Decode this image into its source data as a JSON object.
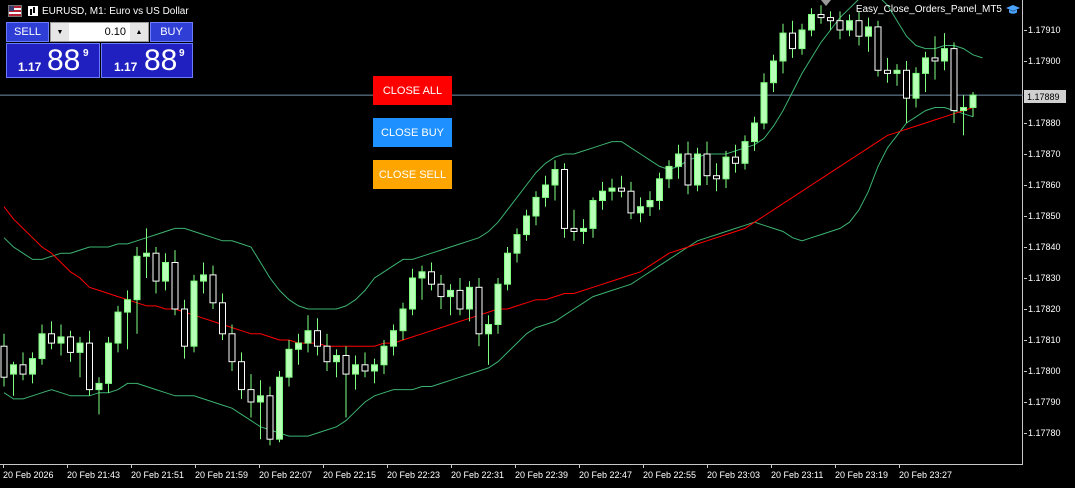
{
  "window": {
    "symbol_title": "EURUSD, M1:  Euro vs US Dollar",
    "ea_name": "Easy_Close_Orders_Panel_MT5"
  },
  "trade_panel": {
    "sell_label": "SELL",
    "buy_label": "BUY",
    "lot_value": "0.10",
    "sell_price": {
      "prefix": "1.17",
      "big": "88",
      "sup": "9"
    },
    "buy_price": {
      "prefix": "1.17",
      "big": "88",
      "sup": "9"
    }
  },
  "close_panel": {
    "close_all": "CLOSE ALL",
    "close_buy": "CLOSE BUY",
    "close_sell": "CLOSE SELL",
    "colors": {
      "close_all": "#ff0000",
      "close_buy": "#1e90ff",
      "close_sell": "#ffa500"
    }
  },
  "price_axis": {
    "labels": [
      "1.17910",
      "1.17900",
      "1.17880",
      "1.17870",
      "1.17860",
      "1.17850",
      "1.17840",
      "1.17830",
      "1.17820",
      "1.17810",
      "1.17800",
      "1.17790",
      "1.17780"
    ],
    "current_price": "1.17889"
  },
  "time_axis": {
    "labels": [
      "20 Feb 2026",
      "20 Feb 21:43",
      "20 Feb 21:51",
      "20 Feb 21:59",
      "20 Feb 22:07",
      "20 Feb 22:15",
      "20 Feb 22:23",
      "20 Feb 22:31",
      "20 Feb 22:39",
      "20 Feb 22:47",
      "20 Feb 22:55",
      "20 Feb 23:03",
      "20 Feb 23:11",
      "20 Feb 23:19",
      "20 Feb 23:27"
    ]
  },
  "chart_data": {
    "type": "candlestick",
    "symbol": "EURUSD",
    "timeframe": "M1",
    "ylim": [
      1.17774,
      1.17921
    ],
    "colors": {
      "bull": "#b8ffb8",
      "bear": "#ffffff",
      "ma": "#ff0000",
      "bands": "#3cb371",
      "current_line": "#6f8fa8"
    },
    "candles": [
      [
        1.17808,
        1.17812,
        1.17795,
        1.17798
      ],
      [
        1.17799,
        1.17803,
        1.17792,
        1.17802
      ],
      [
        1.17802,
        1.17806,
        1.17797,
        1.17799
      ],
      [
        1.17799,
        1.17806,
        1.17796,
        1.17804
      ],
      [
        1.17804,
        1.17815,
        1.17802,
        1.17812
      ],
      [
        1.17812,
        1.17816,
        1.17807,
        1.17809
      ],
      [
        1.17809,
        1.17815,
        1.17805,
        1.17811
      ],
      [
        1.17811,
        1.17813,
        1.17803,
        1.17806
      ],
      [
        1.17806,
        1.17811,
        1.17798,
        1.17809
      ],
      [
        1.17809,
        1.17813,
        1.17792,
        1.17794
      ],
      [
        1.17794,
        1.17798,
        1.17786,
        1.17796
      ],
      [
        1.17796,
        1.17811,
        1.17793,
        1.17809
      ],
      [
        1.17809,
        1.17821,
        1.17806,
        1.17819
      ],
      [
        1.17819,
        1.17826,
        1.17807,
        1.17823
      ],
      [
        1.17823,
        1.1784,
        1.17812,
        1.17837
      ],
      [
        1.17837,
        1.17846,
        1.1783,
        1.17838
      ],
      [
        1.17838,
        1.1784,
        1.17825,
        1.17829
      ],
      [
        1.17829,
        1.17838,
        1.17826,
        1.17835
      ],
      [
        1.17835,
        1.17839,
        1.17818,
        1.1782
      ],
      [
        1.1782,
        1.17823,
        1.17804,
        1.17808
      ],
      [
        1.17808,
        1.17831,
        1.17806,
        1.17829
      ],
      [
        1.17829,
        1.17835,
        1.17825,
        1.17831
      ],
      [
        1.17831,
        1.17834,
        1.1782,
        1.17822
      ],
      [
        1.17822,
        1.17825,
        1.1781,
        1.17812
      ],
      [
        1.17812,
        1.17815,
        1.178,
        1.17803
      ],
      [
        1.17803,
        1.17806,
        1.17791,
        1.17794
      ],
      [
        1.17794,
        1.17799,
        1.17785,
        1.1779
      ],
      [
        1.1779,
        1.17797,
        1.17778,
        1.17792
      ],
      [
        1.17792,
        1.17795,
        1.17776,
        1.17778
      ],
      [
        1.17778,
        1.178,
        1.17777,
        1.17798
      ],
      [
        1.17798,
        1.1781,
        1.17795,
        1.17807
      ],
      [
        1.17807,
        1.17812,
        1.17802,
        1.17809
      ],
      [
        1.17809,
        1.17818,
        1.17806,
        1.17813
      ],
      [
        1.17813,
        1.17817,
        1.17805,
        1.17808
      ],
      [
        1.17808,
        1.17812,
        1.178,
        1.17803
      ],
      [
        1.17803,
        1.17807,
        1.17798,
        1.17805
      ],
      [
        1.17805,
        1.17808,
        1.17785,
        1.17799
      ],
      [
        1.17799,
        1.17805,
        1.17794,
        1.17802
      ],
      [
        1.17802,
        1.17806,
        1.17798,
        1.178
      ],
      [
        1.178,
        1.17804,
        1.17796,
        1.17802
      ],
      [
        1.17802,
        1.1781,
        1.17799,
        1.17808
      ],
      [
        1.17808,
        1.17815,
        1.17805,
        1.17813
      ],
      [
        1.17813,
        1.17822,
        1.1781,
        1.1782
      ],
      [
        1.1782,
        1.17833,
        1.17818,
        1.1783
      ],
      [
        1.1783,
        1.17834,
        1.17823,
        1.17832
      ],
      [
        1.17832,
        1.17835,
        1.17826,
        1.17828
      ],
      [
        1.17828,
        1.17831,
        1.1782,
        1.17824
      ],
      [
        1.17824,
        1.17828,
        1.17818,
        1.17826
      ],
      [
        1.17826,
        1.1783,
        1.17818,
        1.1782
      ],
      [
        1.1782,
        1.17829,
        1.17816,
        1.17827
      ],
      [
        1.17827,
        1.1783,
        1.17808,
        1.17812
      ],
      [
        1.17812,
        1.17818,
        1.17802,
        1.17815
      ],
      [
        1.17815,
        1.1783,
        1.17812,
        1.17828
      ],
      [
        1.17828,
        1.1784,
        1.17826,
        1.17838
      ],
      [
        1.17838,
        1.17846,
        1.17835,
        1.17844
      ],
      [
        1.17844,
        1.17852,
        1.17842,
        1.1785
      ],
      [
        1.1785,
        1.17858,
        1.17847,
        1.17856
      ],
      [
        1.17856,
        1.17863,
        1.17853,
        1.1786
      ],
      [
        1.1786,
        1.17868,
        1.17855,
        1.17865
      ],
      [
        1.17865,
        1.17867,
        1.17843,
        1.17846
      ],
      [
        1.17846,
        1.17852,
        1.17842,
        1.17845
      ],
      [
        1.17845,
        1.17849,
        1.17841,
        1.17846
      ],
      [
        1.17846,
        1.17856,
        1.17843,
        1.17855
      ],
      [
        1.17855,
        1.17861,
        1.17852,
        1.17858
      ],
      [
        1.17858,
        1.17862,
        1.17855,
        1.17859
      ],
      [
        1.17859,
        1.17863,
        1.17856,
        1.17858
      ],
      [
        1.17858,
        1.17861,
        1.17849,
        1.17851
      ],
      [
        1.17851,
        1.17856,
        1.17848,
        1.17853
      ],
      [
        1.17853,
        1.17858,
        1.1785,
        1.17855
      ],
      [
        1.17855,
        1.17864,
        1.17852,
        1.17862
      ],
      [
        1.17862,
        1.17868,
        1.17859,
        1.17866
      ],
      [
        1.17866,
        1.17873,
        1.17862,
        1.1787
      ],
      [
        1.1787,
        1.17874,
        1.17857,
        1.1786
      ],
      [
        1.1786,
        1.17872,
        1.17858,
        1.1787
      ],
      [
        1.1787,
        1.17874,
        1.1786,
        1.17863
      ],
      [
        1.17863,
        1.17867,
        1.17858,
        1.17862
      ],
      [
        1.17862,
        1.17871,
        1.17859,
        1.17869
      ],
      [
        1.17869,
        1.17873,
        1.17864,
        1.17867
      ],
      [
        1.17867,
        1.17876,
        1.17865,
        1.17874
      ],
      [
        1.17874,
        1.17882,
        1.17871,
        1.1788
      ],
      [
        1.1788,
        1.17896,
        1.17878,
        1.17893
      ],
      [
        1.17893,
        1.17902,
        1.1789,
        1.179
      ],
      [
        1.179,
        1.17912,
        1.17896,
        1.17909
      ],
      [
        1.17909,
        1.17913,
        1.17901,
        1.17904
      ],
      [
        1.17904,
        1.17912,
        1.17902,
        1.1791
      ],
      [
        1.1791,
        1.17917,
        1.17908,
        1.17915
      ],
      [
        1.17915,
        1.17918,
        1.17912,
        1.17914
      ],
      [
        1.17914,
        1.17916,
        1.1791,
        1.17913
      ],
      [
        1.17913,
        1.17916,
        1.17907,
        1.1791
      ],
      [
        1.1791,
        1.17915,
        1.17908,
        1.17913
      ],
      [
        1.17913,
        1.17916,
        1.17905,
        1.17908
      ],
      [
        1.17908,
        1.17914,
        1.17903,
        1.17911
      ],
      [
        1.17911,
        1.17913,
        1.17895,
        1.17897
      ],
      [
        1.17897,
        1.17901,
        1.17893,
        1.17896
      ],
      [
        1.17896,
        1.17899,
        1.17892,
        1.17897
      ],
      [
        1.17897,
        1.179,
        1.1788,
        1.17888
      ],
      [
        1.17888,
        1.17898,
        1.17885,
        1.17896
      ],
      [
        1.17896,
        1.17903,
        1.1789,
        1.17901
      ],
      [
        1.17901,
        1.17908,
        1.17894,
        1.179
      ],
      [
        1.179,
        1.17909,
        1.17897,
        1.17904
      ],
      [
        1.17904,
        1.17906,
        1.1788,
        1.17884
      ],
      [
        1.17884,
        1.17889,
        1.17876,
        1.17885
      ],
      [
        1.17885,
        1.1789,
        1.17882,
        1.17889
      ]
    ],
    "ma": [
      1.17853,
      1.17849,
      1.17846,
      1.17843,
      1.1784,
      1.17838,
      1.17835,
      1.17832,
      1.1783,
      1.17827,
      1.17826,
      1.17825,
      1.17824,
      1.17823,
      1.17822,
      1.17821,
      1.17821,
      1.1782,
      1.1782,
      1.17819,
      1.17818,
      1.17817,
      1.17816,
      1.17815,
      1.17814,
      1.17813,
      1.17812,
      1.17812,
      1.17811,
      1.1781,
      1.1781,
      1.17809,
      1.17809,
      1.17809,
      1.17808,
      1.17808,
      1.17808,
      1.17808,
      1.17808,
      1.17808,
      1.17809,
      1.17809,
      1.1781,
      1.17811,
      1.17812,
      1.17813,
      1.17814,
      1.17815,
      1.17816,
      1.17817,
      1.17818,
      1.17819,
      1.1782,
      1.1782,
      1.17821,
      1.17822,
      1.17823,
      1.17823,
      1.17824,
      1.17825,
      1.17825,
      1.17826,
      1.17827,
      1.17828,
      1.17829,
      1.1783,
      1.17831,
      1.17832,
      1.17834,
      1.17836,
      1.17838,
      1.17839,
      1.1784,
      1.17841,
      1.17842,
      1.17843,
      1.17844,
      1.17845,
      1.17846,
      1.17848,
      1.1785,
      1.17852,
      1.17854,
      1.17856,
      1.17858,
      1.1786,
      1.17862,
      1.17864,
      1.17866,
      1.17868,
      1.1787,
      1.17872,
      1.17874,
      1.17876,
      1.17877,
      1.17878,
      1.17879,
      1.1788,
      1.17881,
      1.17882,
      1.17883,
      1.17884,
      1.17885
    ],
    "bb_upper": [
      1.17843,
      1.1784,
      1.17838,
      1.17836,
      1.17836,
      1.17837,
      1.17838,
      1.17838,
      1.17839,
      1.1784,
      1.1784,
      1.1784,
      1.17841,
      1.17841,
      1.17842,
      1.17843,
      1.17844,
      1.17845,
      1.17846,
      1.17846,
      1.17845,
      1.17844,
      1.17843,
      1.17842,
      1.17842,
      1.17841,
      1.1784,
      1.17835,
      1.1783,
      1.17826,
      1.17823,
      1.17821,
      1.1782,
      1.1782,
      1.1782,
      1.1782,
      1.17821,
      1.17823,
      1.17826,
      1.1783,
      1.17832,
      1.17834,
      1.17836,
      1.17836,
      1.17837,
      1.17838,
      1.17839,
      1.1784,
      1.17841,
      1.17842,
      1.17843,
      1.17845,
      1.17848,
      1.17852,
      1.17856,
      1.1786,
      1.17864,
      1.17867,
      1.17869,
      1.1787,
      1.1787,
      1.17871,
      1.17872,
      1.17873,
      1.17874,
      1.17874,
      1.17872,
      1.1787,
      1.17868,
      1.17866,
      1.17865,
      1.17866,
      1.17868,
      1.17869,
      1.1787,
      1.1787,
      1.1787,
      1.17871,
      1.17872,
      1.17873,
      1.17875,
      1.17879,
      1.17884,
      1.1789,
      1.17896,
      1.17901,
      1.17906,
      1.1791,
      1.17914,
      1.17917,
      1.1792,
      1.17921,
      1.17921,
      1.17918,
      1.17913,
      1.17908,
      1.17905,
      1.17904,
      1.17904,
      1.17905,
      1.17905,
      1.17904,
      1.17902,
      1.17901
    ],
    "bb_lower": [
      1.17793,
      1.17791,
      1.17791,
      1.17792,
      1.17793,
      1.17794,
      1.17793,
      1.17792,
      1.17792,
      1.17792,
      1.17793,
      1.17793,
      1.17794,
      1.17796,
      1.17796,
      1.17795,
      1.17794,
      1.17793,
      1.17792,
      1.17792,
      1.17792,
      1.17791,
      1.1779,
      1.17789,
      1.17788,
      1.17786,
      1.17784,
      1.17782,
      1.17781,
      1.1778,
      1.17779,
      1.17779,
      1.17779,
      1.1778,
      1.17781,
      1.17782,
      1.17784,
      1.17787,
      1.1779,
      1.17792,
      1.17793,
      1.17794,
      1.17794,
      1.17794,
      1.17795,
      1.17795,
      1.17796,
      1.17797,
      1.17798,
      1.17799,
      1.178,
      1.17801,
      1.17803,
      1.17806,
      1.17809,
      1.17812,
      1.17814,
      1.17815,
      1.17816,
      1.17818,
      1.1782,
      1.17822,
      1.17824,
      1.17825,
      1.17826,
      1.17827,
      1.17828,
      1.1783,
      1.17832,
      1.17834,
      1.17836,
      1.17838,
      1.1784,
      1.17842,
      1.17843,
      1.17844,
      1.17845,
      1.17846,
      1.17847,
      1.17848,
      1.17847,
      1.17846,
      1.17845,
      1.17843,
      1.17842,
      1.17843,
      1.17844,
      1.17845,
      1.17846,
      1.17848,
      1.17852,
      1.17858,
      1.17866,
      1.17872,
      1.17876,
      1.1788,
      1.17882,
      1.17884,
      1.17885,
      1.17885,
      1.17884,
      1.17883,
      1.17882
    ]
  }
}
